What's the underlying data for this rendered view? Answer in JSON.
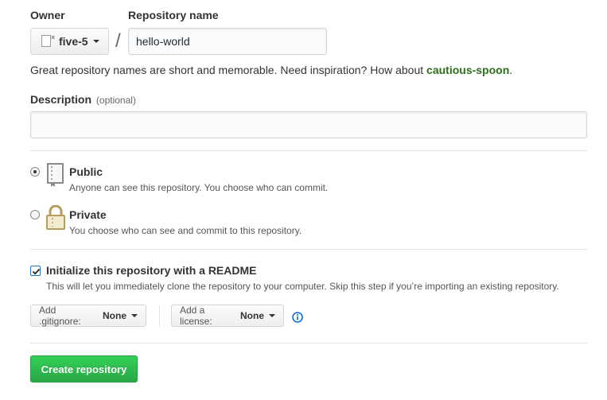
{
  "owner": {
    "label": "Owner",
    "value": "five-5"
  },
  "repo": {
    "label": "Repository name",
    "value": "hello-world",
    "separator": "/"
  },
  "hint": {
    "text": "Great repository names are short and memorable. Need inspiration? How about ",
    "suggestion": "cautious-spoon",
    "suffix": "."
  },
  "description": {
    "label": "Description",
    "optional": "(optional)",
    "value": ""
  },
  "visibility": {
    "selected": "public",
    "public": {
      "title": "Public",
      "desc": "Anyone can see this repository. You choose who can commit.",
      "icon": "repo-book-icon"
    },
    "private": {
      "title": "Private",
      "desc": "You choose who can see and commit to this repository.",
      "icon": "lock-icon"
    }
  },
  "readme": {
    "checked": true,
    "title": "Initialize this repository with a README",
    "desc": "This will let you immediately clone the repository to your computer. Skip this step if you’re importing an existing repository."
  },
  "gitignore": {
    "label": "Add .gitignore:",
    "value": "None"
  },
  "license": {
    "label": "Add a license:",
    "value": "None"
  },
  "create_button": "Create repository",
  "colors": {
    "accent_green": "#28a745",
    "suggestion_green": "#2c6e1e",
    "info_blue": "#0366d6"
  }
}
